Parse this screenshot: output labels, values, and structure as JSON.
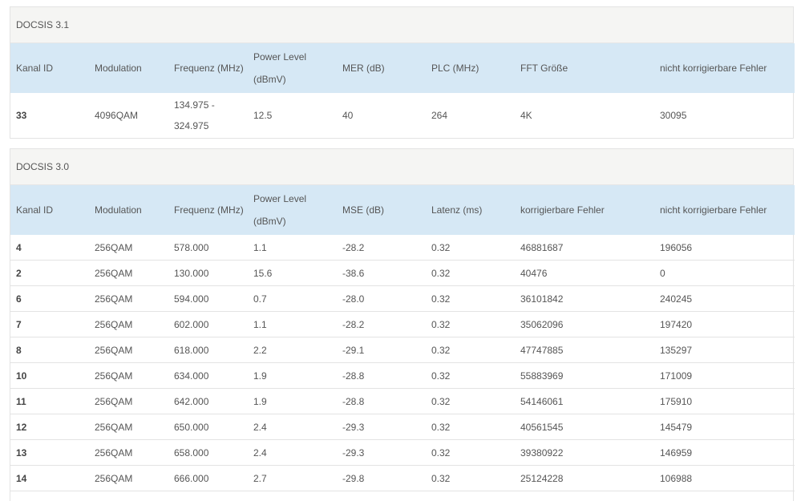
{
  "docsis31": {
    "title": "DOCSIS 3.1",
    "headers": [
      "Kanal ID",
      "Modulation",
      "Frequenz (MHz)",
      "Power Level (dBmV)",
      "MER (dB)",
      "PLC (MHz)",
      "FFT Größe",
      "nicht korrigierbare Fehler"
    ],
    "row": {
      "id": "33",
      "modulation": "4096QAM",
      "frequency_line1": "134.975 -",
      "frequency_line2": "324.975",
      "power": "12.5",
      "mer": "40",
      "plc": "264",
      "fft": "4K",
      "uncorrectable": "30095"
    }
  },
  "docsis30": {
    "title": "DOCSIS 3.0",
    "headers": [
      "Kanal ID",
      "Modulation",
      "Frequenz (MHz)",
      "Power Level (dBmV)",
      "MSE (dB)",
      "Latenz (ms)",
      "korrigierbare Fehler",
      "nicht korrigierbare Fehler"
    ],
    "rows": [
      [
        "4",
        "256QAM",
        "578.000",
        "1.1",
        "-28.2",
        "0.32",
        "46881687",
        "196056"
      ],
      [
        "2",
        "256QAM",
        "130.000",
        "15.6",
        "-38.6",
        "0.32",
        "40476",
        "0"
      ],
      [
        "6",
        "256QAM",
        "594.000",
        "0.7",
        "-28.0",
        "0.32",
        "36101842",
        "240245"
      ],
      [
        "7",
        "256QAM",
        "602.000",
        "1.1",
        "-28.2",
        "0.32",
        "35062096",
        "197420"
      ],
      [
        "8",
        "256QAM",
        "618.000",
        "2.2",
        "-29.1",
        "0.32",
        "47747885",
        "135297"
      ],
      [
        "10",
        "256QAM",
        "634.000",
        "1.9",
        "-28.8",
        "0.32",
        "55883969",
        "171009"
      ],
      [
        "11",
        "256QAM",
        "642.000",
        "1.9",
        "-28.8",
        "0.32",
        "54146061",
        "175910"
      ],
      [
        "12",
        "256QAM",
        "650.000",
        "2.4",
        "-29.3",
        "0.32",
        "40561545",
        "145479"
      ],
      [
        "13",
        "256QAM",
        "658.000",
        "2.4",
        "-29.3",
        "0.32",
        "39380922",
        "146959"
      ],
      [
        "14",
        "256QAM",
        "666.000",
        "2.7",
        "-29.8",
        "0.32",
        "25124228",
        "106988"
      ]
    ]
  }
}
